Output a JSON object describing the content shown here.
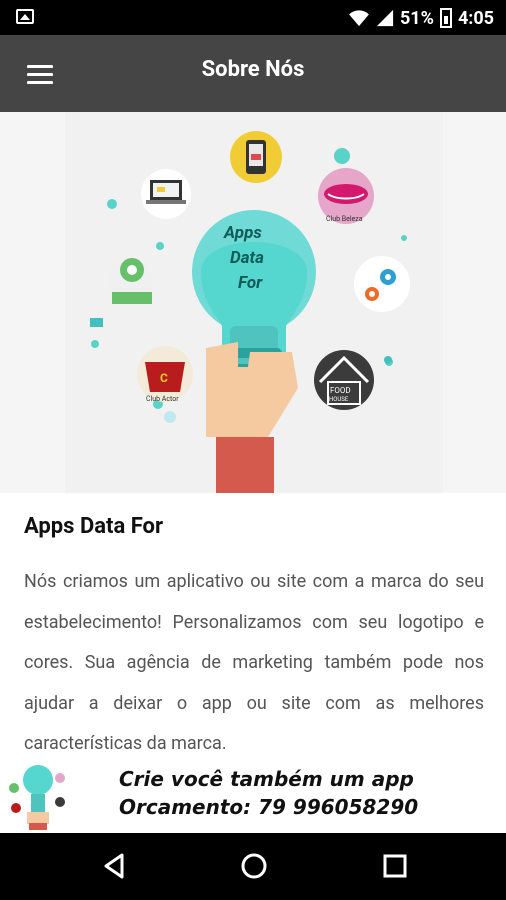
{
  "status_bar": {
    "battery_percent": "51%",
    "time": "4:05",
    "icons": [
      "image-icon",
      "wifi-icon",
      "signal-icon",
      "battery-icon"
    ]
  },
  "app_bar": {
    "title": "Sobre Nós",
    "menu_icon": "menu-icon"
  },
  "hero": {
    "bulb_text": [
      "Apps",
      "Data",
      "For"
    ],
    "logo_caption": "Club Actor",
    "food_text": "FOOD",
    "food_house": "HOUSE",
    "lips_caption": "Club Beleza"
  },
  "content": {
    "heading": "Apps Data For",
    "description": "Nós criamos um aplicativo ou site com a marca do seu estabelecimento! Personalizamos com seu logotipo e cores. Sua agência de marketing também pode nos ajudar a deixar o app ou site com as melhores características da marca."
  },
  "banner": {
    "line1": "Crie você também um app",
    "line2": "Orcamento: 79 996058290"
  },
  "nav_bar": {
    "buttons": [
      "back-icon",
      "home-icon",
      "recents-icon"
    ]
  },
  "colors": {
    "app_bar": "#454545",
    "status_bar": "#000000",
    "teal": "#35c8c1"
  }
}
